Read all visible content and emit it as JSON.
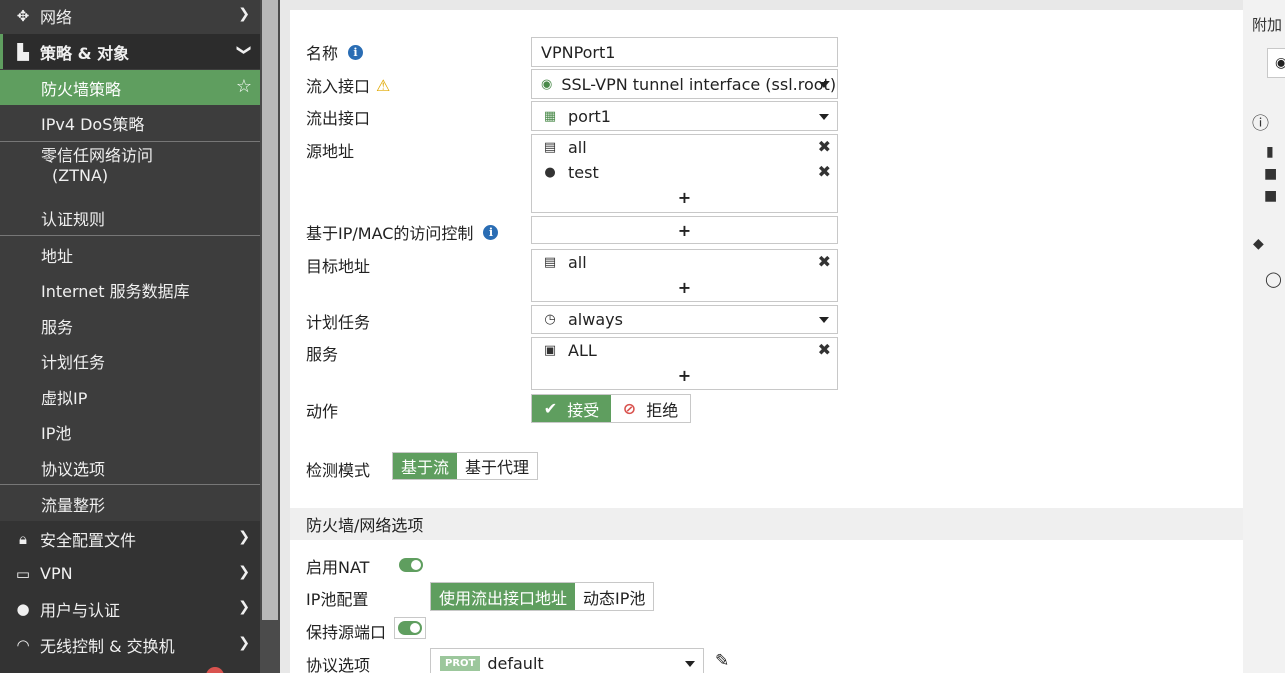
{
  "sidebar": {
    "items": [
      {
        "label": "网络",
        "icon": "network-icon"
      },
      {
        "label": "策略 & 对象",
        "icon": "policy-icon"
      },
      {
        "label": "防火墙策略"
      },
      {
        "label": "IPv4 DoS策略"
      },
      {
        "label": "零信任网络访问"
      },
      {
        "label": "(ZTNA)"
      },
      {
        "label": "认证规则"
      },
      {
        "label": "地址"
      },
      {
        "label": "Internet 服务数据库"
      },
      {
        "label": "服务"
      },
      {
        "label": "计划任务"
      },
      {
        "label": "虚拟IP"
      },
      {
        "label": "IP池"
      },
      {
        "label": "协议选项"
      },
      {
        "label": "流量整形"
      },
      {
        "label": "安全配置文件",
        "icon": "lock-icon"
      },
      {
        "label": "VPN",
        "icon": "laptop-icon"
      },
      {
        "label": "用户与认证",
        "icon": "user-icon"
      },
      {
        "label": "无线控制 & 交换机",
        "icon": "wifi-icon"
      }
    ]
  },
  "form": {
    "name_label": "名称",
    "name_value": "VPNPort1",
    "incoming_label": "流入接口",
    "incoming_value": "SSL-VPN tunnel interface (ssl.root)",
    "outgoing_label": "流出接口",
    "outgoing_value": "port1",
    "source_label": "源地址",
    "source_entries": [
      "all",
      "test"
    ],
    "ipmac_label": "基于IP/MAC的访问控制",
    "dest_label": "目标地址",
    "dest_entries": [
      "all"
    ],
    "schedule_label": "计划任务",
    "schedule_value": "always",
    "service_label": "服务",
    "service_entries": [
      "ALL"
    ],
    "action_label": "动作",
    "action_accept": "接受",
    "action_deny": "拒绝",
    "inspect_label": "检测模式",
    "inspect_flow": "基于流",
    "inspect_proxy": "基于代理",
    "plus": "+"
  },
  "fw_section": {
    "title": "防火墙/网络选项",
    "nat_label": "启用NAT",
    "ippool_label": "IP池配置",
    "ippool_use": "使用流出接口地址",
    "ippool_dynamic": "动态IP池",
    "preserve_label": "保持源端口",
    "proto_label": "协议选项",
    "proto_badge": "PROT",
    "proto_value": "default"
  },
  "right_panel": {
    "title": "附加"
  }
}
